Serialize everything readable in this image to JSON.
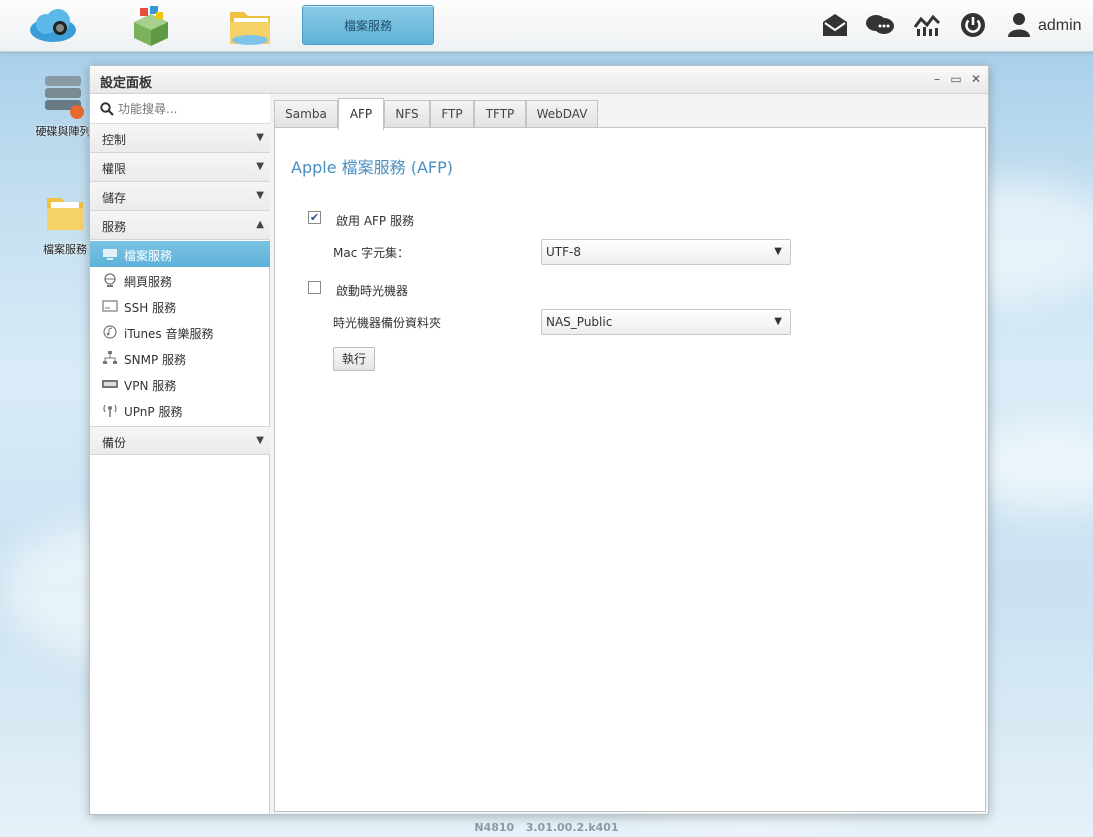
{
  "taskbar": {
    "active_app": "檔案服務",
    "user": "admin"
  },
  "desktop": {
    "icons": [
      {
        "label": "硬碟與陣列"
      },
      {
        "label": "檔案服務"
      }
    ]
  },
  "window": {
    "title": "設定面板"
  },
  "sidebar": {
    "search_placeholder": "功能搜尋...",
    "categories": [
      {
        "label": "控制"
      },
      {
        "label": "權限"
      },
      {
        "label": "儲存"
      },
      {
        "label": "服務"
      },
      {
        "label": "備份"
      }
    ],
    "services": [
      {
        "label": "檔案服務",
        "icon": "file-service-icon"
      },
      {
        "label": "網頁服務",
        "icon": "web-service-icon"
      },
      {
        "label": "SSH 服務",
        "icon": "ssh-terminal-icon"
      },
      {
        "label": "iTunes 音樂服務",
        "icon": "music-note-icon"
      },
      {
        "label": "SNMP 服務",
        "icon": "network-tree-icon"
      },
      {
        "label": "VPN 服務",
        "icon": "vpn-icon"
      },
      {
        "label": "UPnP 服務",
        "icon": "antenna-icon"
      }
    ]
  },
  "tabs": [
    {
      "label": "Samba"
    },
    {
      "label": "AFP"
    },
    {
      "label": "NFS"
    },
    {
      "label": "FTP"
    },
    {
      "label": "TFTP"
    },
    {
      "label": "WebDAV"
    }
  ],
  "afp": {
    "title": "Apple 檔案服務 (AFP)",
    "enable_label": "啟用 AFP 服務",
    "enable_checked": true,
    "charset_label": "Mac 字元集：",
    "charset_value": "UTF-8",
    "timemachine_label": "啟動時光機器",
    "timemachine_checked": false,
    "tm_folder_label": "時光機器備份資料夾",
    "tm_folder_value": "NAS_Public",
    "execute_label": "執行"
  },
  "footer": {
    "model": "N4810",
    "version": "3.01.00.2.k401"
  },
  "colors": {
    "accent": "#5db1d9",
    "title_blue": "#4a8fbf"
  }
}
